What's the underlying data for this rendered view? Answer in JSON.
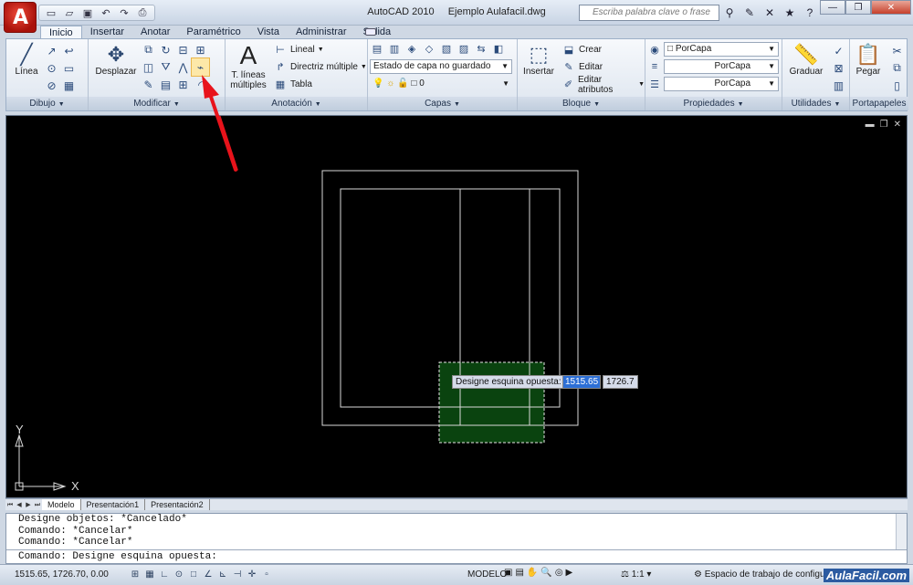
{
  "app": {
    "title_app": "AutoCAD 2010",
    "title_file": "Ejemplo Aulafacil.dwg",
    "app_button_letter": "A",
    "search_placeholder": "Escriba palabra clave o frase",
    "qat_icons": [
      "new-icon",
      "open-icon",
      "save-icon",
      "undo-icon",
      "redo-icon",
      "print-icon"
    ],
    "title_icons": [
      "binoculars-icon",
      "tools-icon",
      "satellite-icon",
      "star-icon",
      "help-icon"
    ]
  },
  "tabs": [
    "Inicio",
    "Insertar",
    "Anotar",
    "Paramétrico",
    "Vista",
    "Administrar",
    "Salida"
  ],
  "ribbon": {
    "dibujo": {
      "footer": "Dibujo",
      "linea_label": "Línea"
    },
    "modificar": {
      "footer": "Modificar",
      "desplazar_label": "Desplazar"
    },
    "anotacion": {
      "footer": "Anotación",
      "text_label_line1": "T. líneas",
      "text_label_line2": "múltiples",
      "lineal": "Lineal",
      "directriz": "Directriz múltiple",
      "tabla": "Tabla"
    },
    "capas": {
      "footer": "Capas",
      "estado": "Estado de capa no guardado",
      "layer_value": "0"
    },
    "bloque": {
      "footer": "Bloque",
      "insertar": "Insertar",
      "crear": "Crear",
      "editar": "Editar",
      "editar_atributos": "Editar atributos"
    },
    "propiedades": {
      "footer": "Propiedades",
      "color": "PorCapa",
      "linetype": "PorCapa",
      "lineweight": "PorCapa"
    },
    "utilidades": {
      "footer": "Utilidades",
      "graduar": "Graduar"
    },
    "portapapeles": {
      "footer": "Portapapeles",
      "pegar": "Pegar"
    }
  },
  "drawing": {
    "tooltip_label": "Designe esquina opuesta:",
    "x_value": "1515.65",
    "y_value": "1726.7",
    "ucs_x": "X",
    "ucs_y": "Y",
    "arrow_color": "#e8131b",
    "selection_color": "#0d5a14"
  },
  "layout_tabs": [
    "Modelo",
    "Presentación1",
    "Presentación2"
  ],
  "command": {
    "history": [
      "Designe objetos: *Cancelado*",
      "Comando: *Cancelar*",
      "Comando: *Cancelar*"
    ],
    "prompt": "Comando: Designe esquina opuesta:"
  },
  "status": {
    "coords": "1515.65, 1726.70, 0.00",
    "modelo": "MODELO",
    "scale": "1:1",
    "workspace": "Espacio de trabajo de configura",
    "brand": "AulaFacil.com"
  }
}
